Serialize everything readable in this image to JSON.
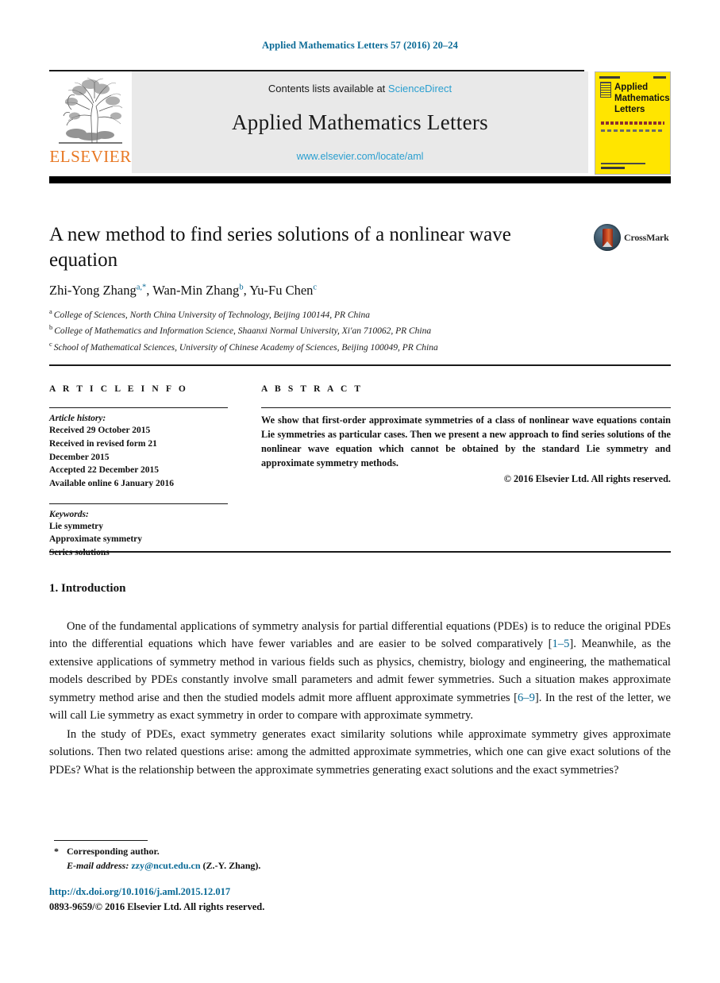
{
  "running_head": "Applied Mathematics Letters 57 (2016) 20–24",
  "journal_header": {
    "publisher_wordmark": "ELSEVIER",
    "contents_prefix": "Contents lists available at",
    "sciencedirect": "ScienceDirect",
    "journal_title": "Applied Mathematics Letters",
    "journal_url": "www.elsevier.com/locate/aml",
    "cover_title": "Applied Mathematics Letters",
    "accent_link_color": "#2a9fd0",
    "elsevier_orange": "#e87722",
    "cover_yellow": "#ffe500"
  },
  "article": {
    "title": "A new method to find series solutions of a nonlinear wave equation",
    "crossmark_label": "CrossMark",
    "authors_html": "Zhi-Yong Zhang<sup>a,*</sup>, Wan-Min Zhang<sup>b</sup>, Yu-Fu Chen<sup>c</sup>",
    "authors_plain": "Zhi-Yong Zhang a,*, Wan-Min Zhang b, Yu-Fu Chen c",
    "affiliations": [
      {
        "mark": "a",
        "text": "College of Sciences, North China University of Technology, Beijing 100144, PR China"
      },
      {
        "mark": "b",
        "text": "College of Mathematics and Information Science, Shaanxi Normal University, Xi'an 710062, PR China"
      },
      {
        "mark": "c",
        "text": "School of Mathematical Sciences, University of Chinese Academy of Sciences, Beijing 100049, PR China"
      }
    ]
  },
  "article_info": {
    "label": "A R T I C L E   I N F O",
    "history_heading": "Article history:",
    "history_lines": [
      "Received 29 October 2015",
      "Received in revised form 21",
      "December 2015",
      "Accepted 22 December 2015",
      "Available online 6 January 2016"
    ],
    "keywords_heading": "Keywords:",
    "keywords": [
      "Lie symmetry",
      "Approximate symmetry",
      "Series solutions"
    ]
  },
  "abstract": {
    "label": "A B S T R A C T",
    "text": "We show that first-order approximate symmetries of a class of nonlinear wave equations contain Lie symmetries as particular cases. Then we present a new approach to find series solutions of the nonlinear wave equation which cannot be obtained by the standard Lie symmetry and approximate symmetry methods.",
    "copyright": "© 2016 Elsevier Ltd. All rights reserved."
  },
  "body": {
    "section_title": "1. Introduction",
    "paragraph_1_a": "One of the fundamental applications of symmetry analysis for partial differential equations (PDEs) is to reduce the original PDEs into the differential equations which have fewer variables and are easier to be solved comparatively [",
    "paragraph_1_cite_1": "1–5",
    "paragraph_1_b": "]. Meanwhile, as the extensive applications of symmetry method in various fields such as physics, chemistry, biology and engineering, the mathematical models described by PDEs constantly involve small parameters and admit fewer symmetries. Such a situation makes approximate symmetry method arise and then the studied models admit more affluent approximate symmetries [",
    "paragraph_1_cite_2": "6–9",
    "paragraph_1_c": "]. In the rest of the letter, we will call Lie symmetry as exact symmetry in order to compare with approximate symmetry.",
    "paragraph_2": "In the study of PDEs, exact symmetry generates exact similarity solutions while approximate symmetry gives approximate solutions. Then two related questions arise: among the admitted approximate symmetries, which one can give exact solutions of the PDEs? What is the relationship between the approximate symmetries generating exact solutions and the exact symmetries?"
  },
  "footnotes": {
    "star_marker": "*",
    "corresponding": "Corresponding author.",
    "email_label": "E-mail address:",
    "email": "zzy@ncut.edu.cn",
    "email_suffix": "(Z.-Y. Zhang)."
  },
  "footer": {
    "doi": "http://dx.doi.org/10.1016/j.aml.2015.12.017",
    "issn_line": "0893-9659/© 2016 Elsevier Ltd. All rights reserved."
  }
}
